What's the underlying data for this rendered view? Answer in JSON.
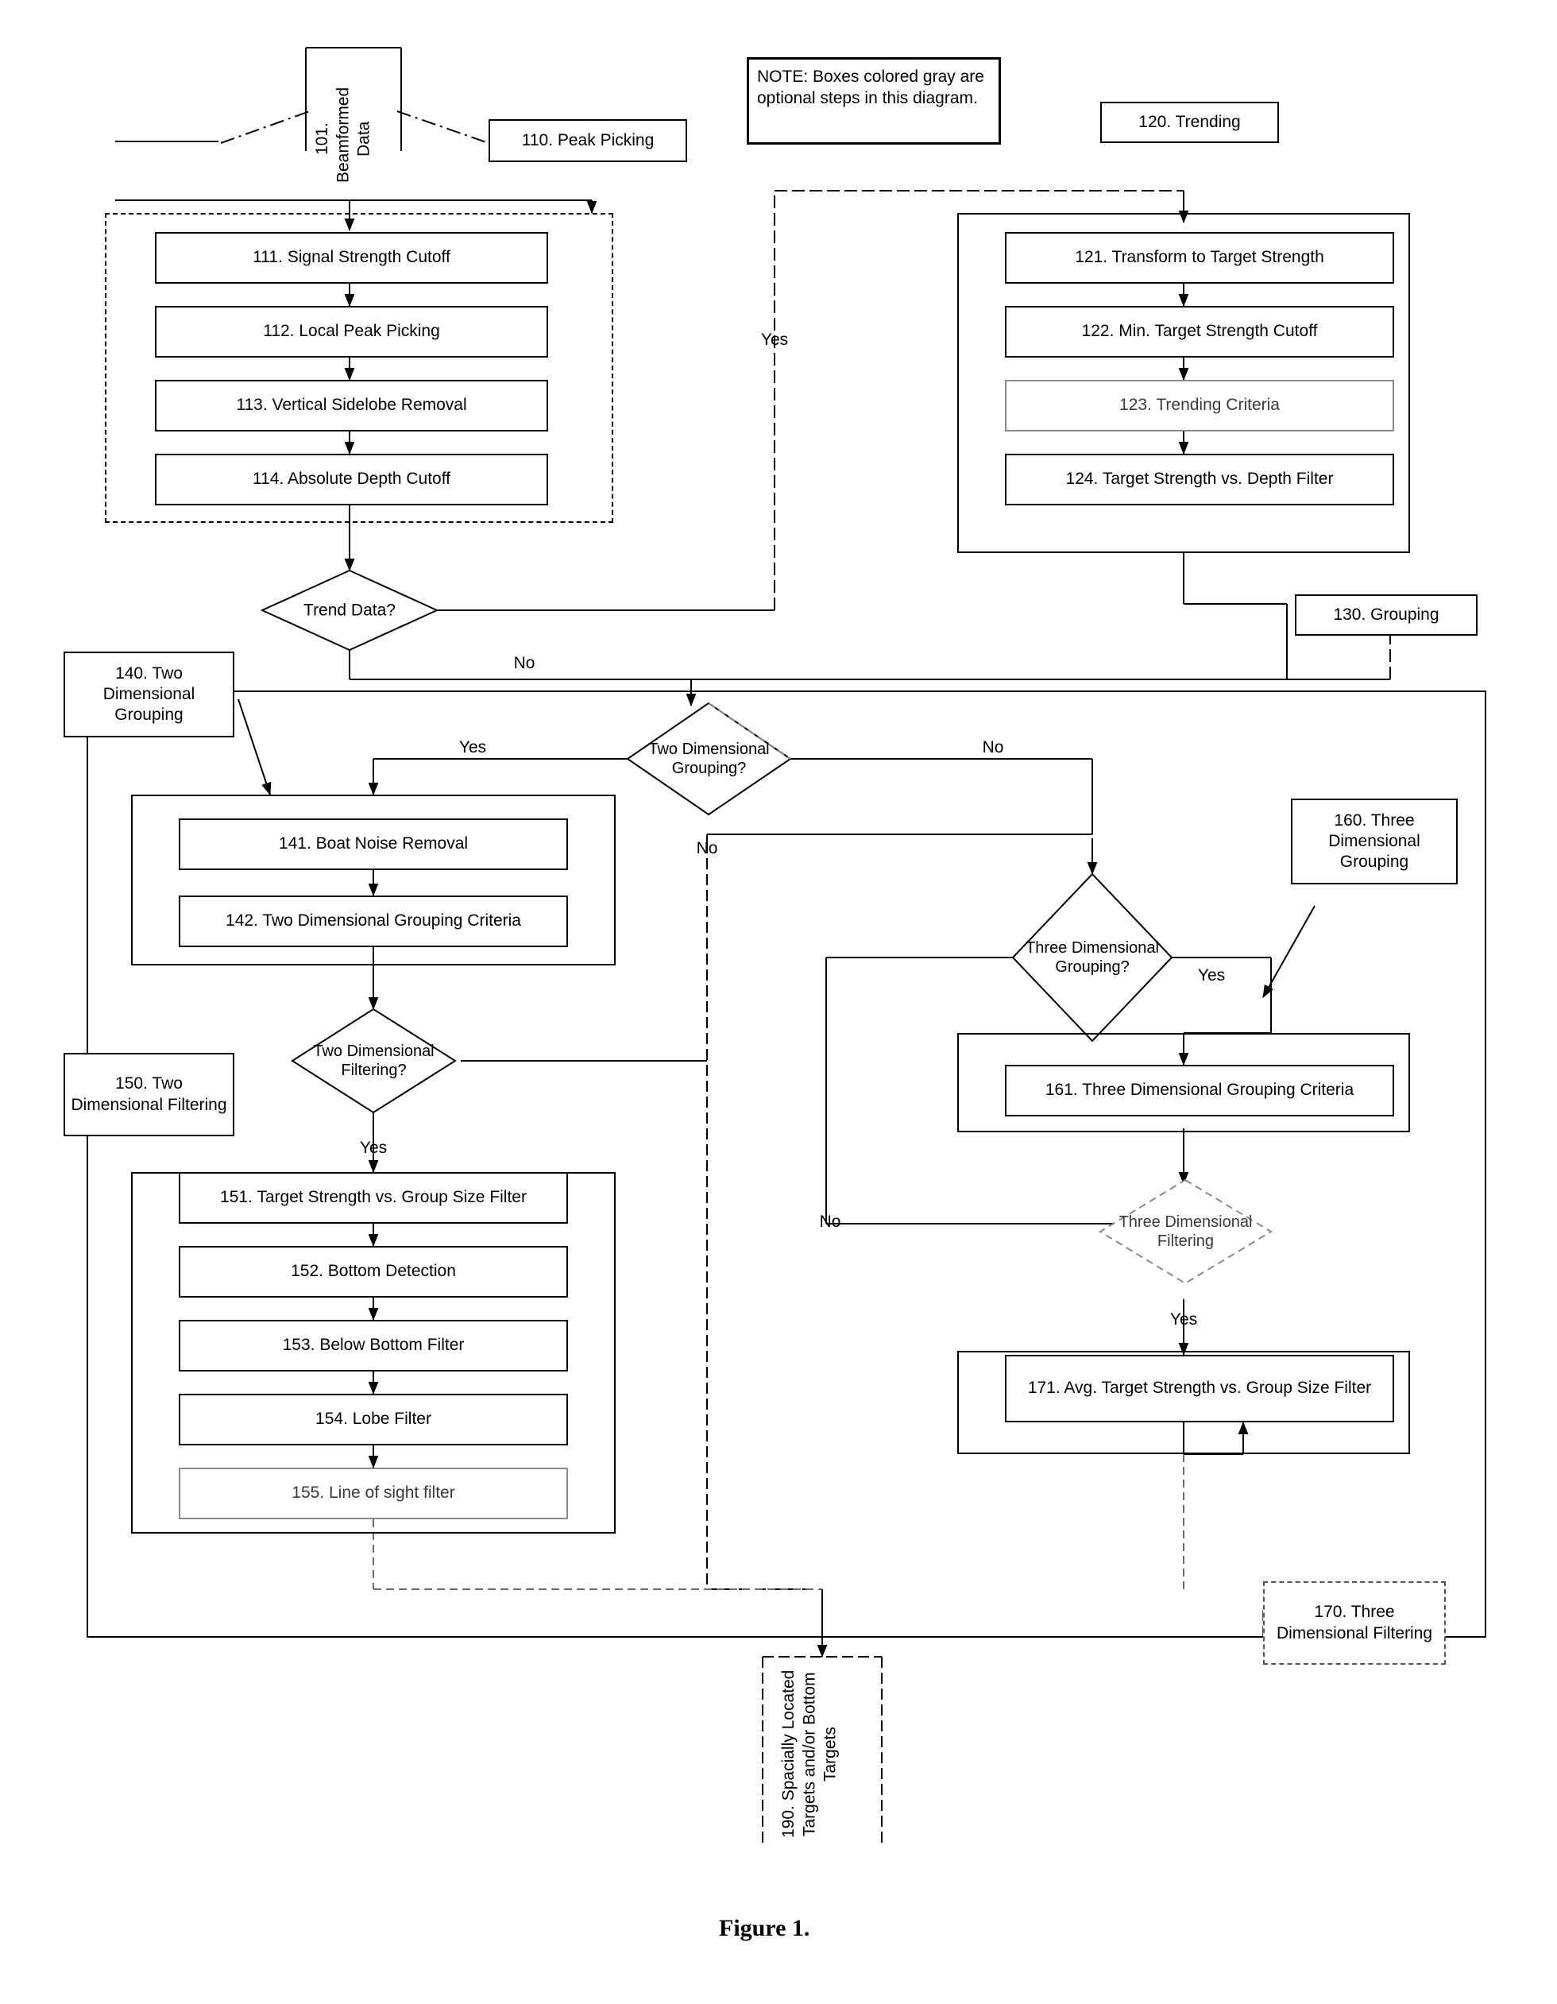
{
  "figure": {
    "caption": "Figure 1."
  },
  "note": {
    "text": "NOTE: Boxes colored gray are optional steps in this diagram."
  },
  "inputs": {
    "beamformed_data": "101. Beamformed Data",
    "output": "190. Spacially Located Targets and/or Bottom Targets"
  },
  "sections": {
    "peak_picking": "110. Peak Picking",
    "trending": "120. Trending",
    "grouping": "130. Grouping",
    "two_dim_grouping": "140. Two Dimensional Grouping",
    "two_dim_filtering": "150. Two Dimensional Filtering",
    "three_dim_grouping": "160. Three Dimensional Grouping",
    "three_dim_filtering": "170. Three Dimensional Filtering"
  },
  "steps": {
    "s111": "111. Signal Strength Cutoff",
    "s112": "112. Local Peak Picking",
    "s113": "113. Vertical Sidelobe Removal",
    "s114": "114. Absolute Depth Cutoff",
    "s121": "121. Transform to Target Strength",
    "s122": "122. Min. Target Strength Cutoff",
    "s123": "123. Trending Criteria",
    "s124": "124. Target Strength vs. Depth Filter",
    "s141": "141. Boat Noise Removal",
    "s142": "142. Two Dimensional Grouping Criteria",
    "s151": "151. Target Strength vs. Group Size Filter",
    "s152": "152. Bottom Detection",
    "s153": "153. Below Bottom Filter",
    "s154": "154. Lobe Filter",
    "s155": "155. Line of sight filter",
    "s161": "161. Three Dimensional Grouping Criteria",
    "s171": "171. Avg. Target Strength vs. Group Size Filter"
  },
  "decisions": {
    "trend_data": "Trend Data?",
    "two_dim_grouping": "Two Dimensional Grouping?",
    "two_dim_filtering": "Two Dimensional Filtering?",
    "three_dim_grouping": "Three Dimensional Grouping?",
    "three_dim_filtering": "Three Dimensional Filtering"
  },
  "labels": {
    "yes_trend": "Yes",
    "no_trend": "No",
    "yes_2dg": "Yes",
    "no_2dg": "No",
    "no_2dg_down": "No",
    "yes_2df": "Yes",
    "yes_3dg": "Yes",
    "no_3dg": "No",
    "yes_3df": "Yes"
  }
}
